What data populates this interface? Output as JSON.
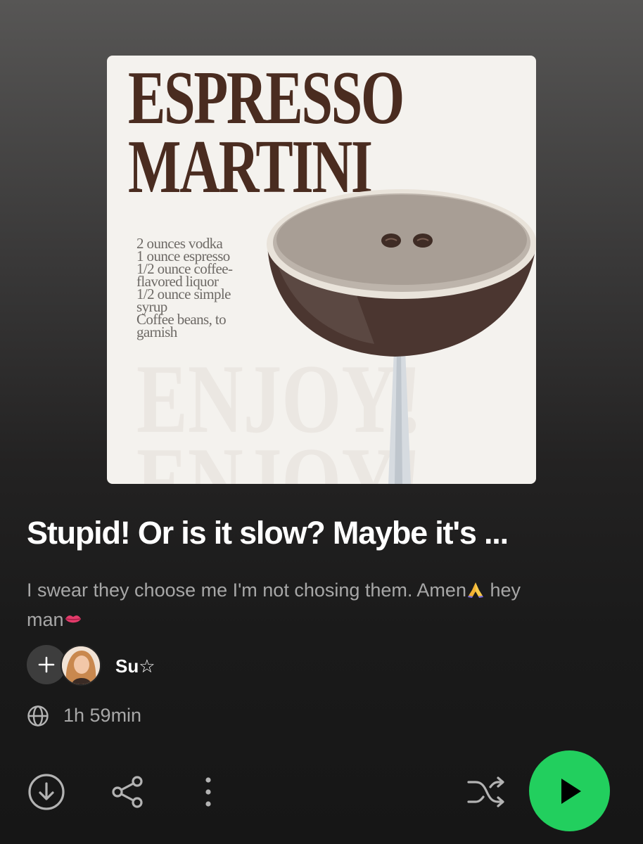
{
  "cover": {
    "title_lines": [
      "ESPRESSO",
      "MARTINI"
    ],
    "recipe": [
      "2 ounces vodka",
      "1 ounce espresso",
      "1/2 ounce coffee-",
      "flavored liquor",
      "1/2 ounce simple",
      "syrup",
      "Coffee beans, to",
      "garnish"
    ],
    "background_word": [
      "ENJOY!",
      "ENJOY!"
    ]
  },
  "playlist": {
    "title": "Stupid! Or is it slow? Maybe it's ...",
    "description": "I swear they choose me I'm not chosing them. Amen",
    "description_tail_1": " hey",
    "description_tail_2": "man",
    "owner_name": "Su☆",
    "duration": "1h 59min"
  },
  "icons": {
    "add": "plus-icon",
    "visibility": "globe-icon",
    "download": "download-icon",
    "share": "share-icon",
    "more": "more-vertical-icon",
    "shuffle": "shuffle-icon",
    "play": "play-icon"
  },
  "colors": {
    "accent": "#1ed760",
    "title": "#ffffff",
    "secondary_text": "#a7a7a7",
    "cover_brown": "#4a2c20"
  }
}
